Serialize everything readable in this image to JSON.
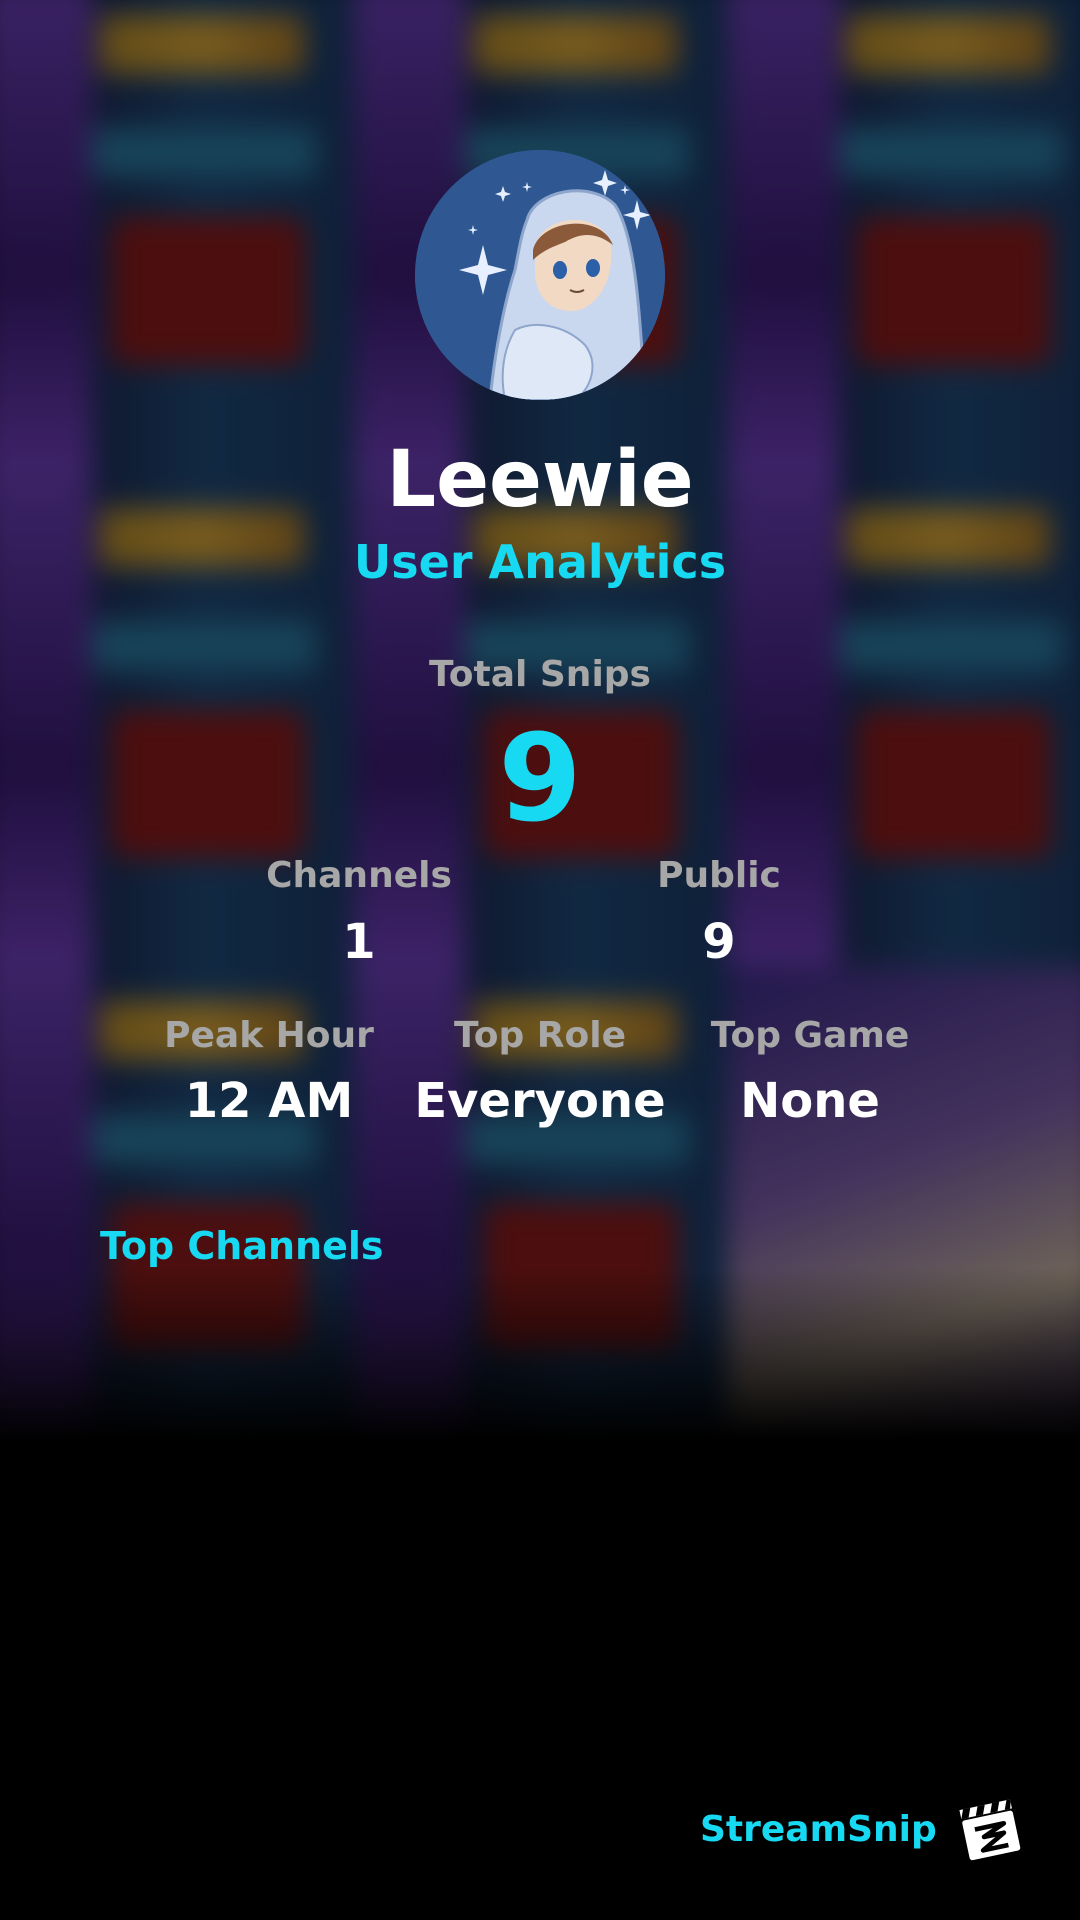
{
  "profile": {
    "username": "Leewie",
    "subtitle": "User Analytics"
  },
  "stats": {
    "total_snips_label": "Total Snips",
    "total_snips_value": "9",
    "channels_label": "Channels",
    "channels_value": "1",
    "public_label": "Public",
    "public_value": "9",
    "peak_hour_label": "Peak Hour",
    "peak_hour_value": "12 AM",
    "top_role_label": "Top Role",
    "top_role_value": "Everyone",
    "top_game_label": "Top Game",
    "top_game_value": "None"
  },
  "sections": {
    "top_channels": "Top Channels"
  },
  "brand": {
    "name": "StreamSnip",
    "logo_icon": "clapperboard-icon"
  },
  "colors": {
    "accent": "#17d9f2",
    "label": "#a7a7a7",
    "text": "#ffffff",
    "background": "#000000"
  }
}
